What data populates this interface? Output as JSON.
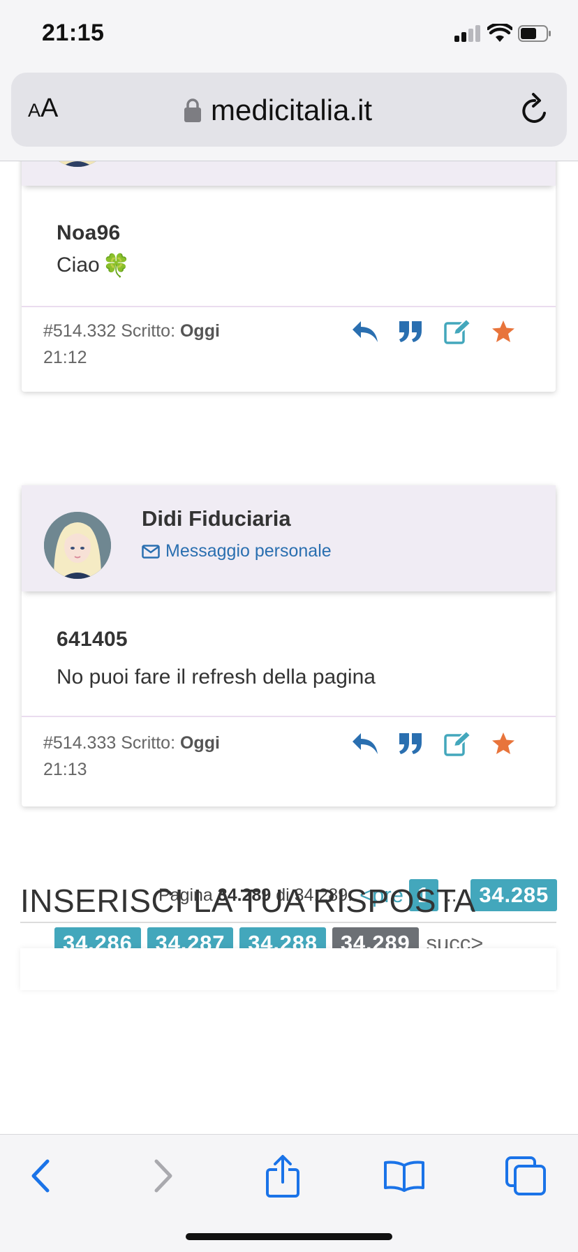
{
  "status_bar": {
    "time": "21:15"
  },
  "browser": {
    "text_size_label_small": "A",
    "text_size_label_large": "A",
    "url": "medicitalia.it"
  },
  "posts": [
    {
      "author": "",
      "title": "Noa96",
      "body": "Ciao",
      "body_emoji": "🍀",
      "number": "#514.332",
      "written_label": "Scritto:",
      "day": "Oggi",
      "time": "21:12"
    },
    {
      "author": "Didi Fiduciaria",
      "pm_label": "Messaggio personale",
      "title": "641405",
      "body": "No puoi fare il refresh della pagina",
      "number": "#514.333",
      "written_label": "Scritto:",
      "day": "Oggi",
      "time": "21:13"
    }
  ],
  "pagination": {
    "page_label": "Pagina",
    "current": "34.289",
    "of_label": "di",
    "total": "34.289:",
    "prev_label": "<pre",
    "first": "1",
    "dots": "...",
    "pages": [
      "34.285",
      "34.286",
      "34.287",
      "34.288",
      "34.289"
    ],
    "next_label": "succ>"
  },
  "reply_section": {
    "title": "INSERISCI LA TUA RISPOSTA"
  },
  "colors": {
    "accent": "#43a7bc",
    "link": "#2a6fb0",
    "star": "#e8743b",
    "header_bg": "#f0ecf4",
    "ios_blue": "#1a73e8"
  },
  "icons": [
    "reply-icon",
    "quote-icon",
    "edit-icon",
    "star-icon",
    "envelope-icon",
    "lock-icon",
    "reload-icon",
    "back-icon",
    "forward-icon",
    "share-icon",
    "bookmarks-icon",
    "tabs-icon"
  ]
}
